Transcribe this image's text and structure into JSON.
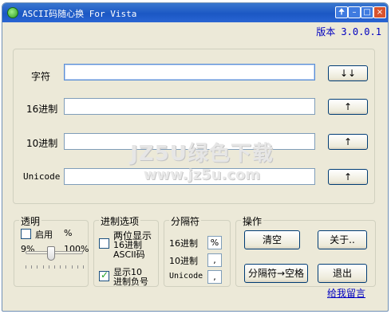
{
  "window": {
    "title": "ASCII码随心换 For Vista",
    "version": "版本 3.0.0.1",
    "controls": {
      "pin": "🠉",
      "minimize": "–",
      "maximize": "□",
      "close": "×"
    }
  },
  "main": {
    "rows": [
      {
        "label": "字符",
        "value": "",
        "button": "↓↓"
      },
      {
        "label": "16进制",
        "value": "",
        "button": "↑"
      },
      {
        "label": "10进制",
        "value": "",
        "button": "↑"
      },
      {
        "label": "Unicode",
        "value": "",
        "button": "↑"
      }
    ],
    "watermark": {
      "line1": "JZ5U绿色下载",
      "line2": "www.jz5u.com"
    }
  },
  "transparency": {
    "title": "透明",
    "enable_label": "启用",
    "enable_checked": false,
    "unit": "%",
    "min_label": "9%",
    "max_label": "100%",
    "value_fraction": 0.45
  },
  "base_options": {
    "title": "进制选项",
    "opt1_line1": "两位显示",
    "opt1_line2": "16进制",
    "opt1_line3": "ASCII码",
    "opt1_checked": false,
    "opt2_line1": "显示10",
    "opt2_line2": "进制负号",
    "opt2_checked": true
  },
  "separators": {
    "title": "分隔符",
    "items": [
      {
        "label": "16进制",
        "value": "%"
      },
      {
        "label": "10进制",
        "value": ","
      },
      {
        "label": "Unicode",
        "value": ","
      }
    ]
  },
  "operations": {
    "title": "操作",
    "clear": "清空",
    "about": "关于..",
    "sep_to_space": "分隔符→空格",
    "exit": "退出"
  },
  "footer": {
    "feedback_link": "给我留言"
  }
}
